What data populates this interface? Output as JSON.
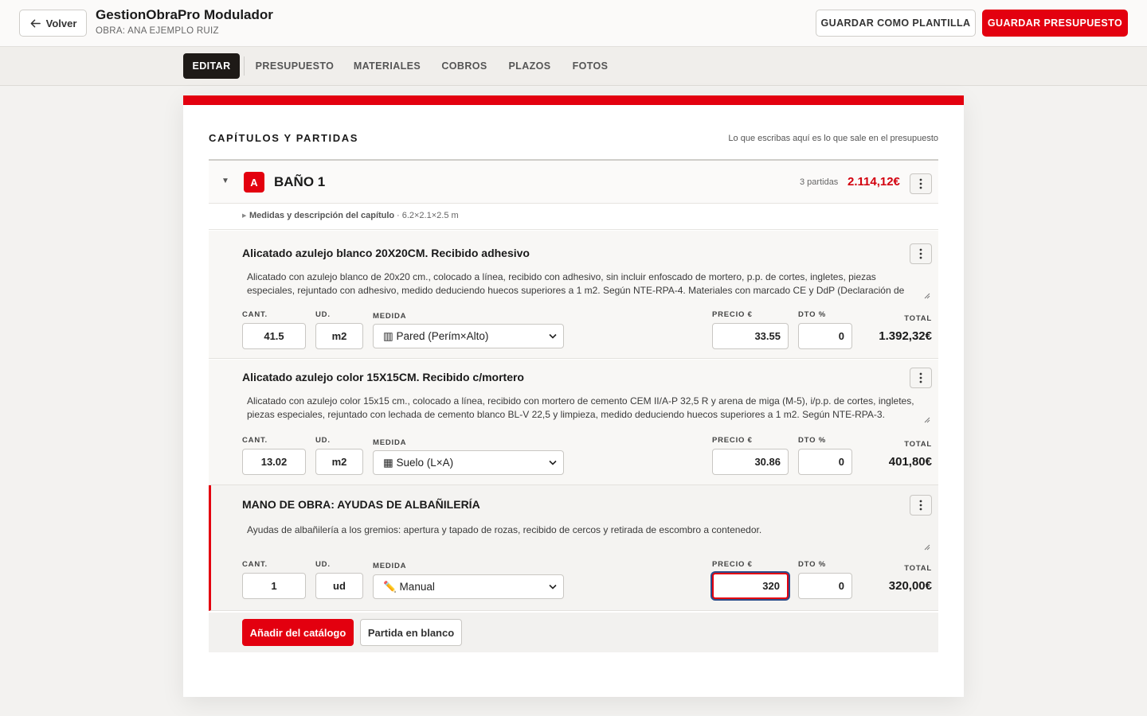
{
  "header": {
    "back_label": "Volver",
    "title": "GestionObraPro Modulador",
    "subtitle": "OBRA: ANA EJEMPLO RUIZ",
    "template_label": "GUARDAR COMO PLANTILLA",
    "save_label": "GUARDAR PRESUPUESTO"
  },
  "tabs": [
    {
      "label": "EDITAR",
      "active": true
    },
    {
      "label": "PRESUPUESTO"
    },
    {
      "label": "MATERIALES"
    },
    {
      "label": "COBROS"
    },
    {
      "label": "PLAZOS"
    },
    {
      "label": "FOTOS"
    }
  ],
  "section": {
    "title": "CAPÍTULOS Y PARTIDAS",
    "hint": "Lo que escribas aquí es lo que sale en el presupuesto"
  },
  "chapter": {
    "badge": "A",
    "name": "BAÑO 1",
    "count": "3 partidas",
    "total": "2.114,12€",
    "meta_label": "Medidas y descripción del capítulo",
    "meta_value": "· 6.2×2.1×2.5 m"
  },
  "labels": {
    "qty": "CANT.",
    "unit": "UD.",
    "measure": "MEDIDA",
    "price": "PRECIO €",
    "discount": "DTO %",
    "total": "TOTAL"
  },
  "items": [
    {
      "title": "Alicatado azulejo blanco 20X20CM. Recibido adhesivo",
      "description": "Alicatado con azulejo blanco de 20x20 cm., colocado a línea, recibido con adhesivo, sin incluir enfoscado de mortero, p.p. de cortes, ingletes, piezas especiales, rejuntado con adhesivo, medido deduciendo huecos superiores a 1 m2. Según NTE-RPA-4. Materiales con marcado CE y DdP (Declaración de",
      "qty": "41.5",
      "unit": "m2",
      "measure": "▥ Pared (Perím×Alto)",
      "price": "33.55",
      "discount": "0",
      "total": "1.392,32€"
    },
    {
      "title": "Alicatado azulejo color 15X15CM. Recibido c/mortero",
      "description": "Alicatado con azulejo color 15x15 cm., colocado a línea, recibido con mortero de cemento CEM II/A-P 32,5 R y arena de miga (M-5), i/p.p. de cortes, ingletes, piezas especiales, rejuntado con lechada de cemento blanco BL-V 22,5 y limpieza, medido deduciendo huecos superiores a 1 m2. Según NTE-RPA-3.",
      "qty": "13.02",
      "unit": "m2",
      "measure": "▦ Suelo (L×A)",
      "price": "30.86",
      "discount": "0",
      "total": "401,80€"
    },
    {
      "title": "MANO DE OBRA: AYUDAS DE ALBAÑILERÍA",
      "description": "Ayudas de albañilería a los gremios: apertura y tapado de rozas, recibido de cercos y retirada de escombro a contenedor.",
      "qty": "1",
      "unit": "ud",
      "measure": "✏️ Manual",
      "price": "320",
      "discount": "0",
      "total": "320,00€"
    }
  ],
  "footer": {
    "catalog_label": "Añadir del catálogo",
    "blank_label": "Partida en blanco"
  },
  "colors": {
    "accent": "#e3000f",
    "dark_tab": "#1e1a17",
    "focus_ring": "#2c4d8a"
  }
}
